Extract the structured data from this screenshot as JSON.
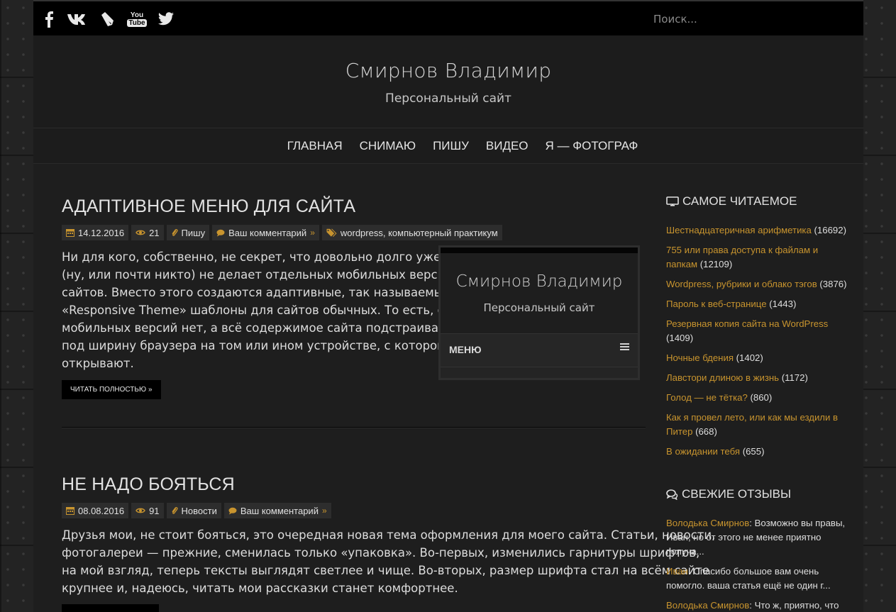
{
  "topbar": {
    "icons": [
      "facebook-icon",
      "vk-icon",
      "livejournal-icon",
      "youtube-icon",
      "twitter-icon"
    ],
    "youtube_you": "You",
    "youtube_tube": "Tube",
    "search_placeholder": "Поиск..."
  },
  "header": {
    "title": "Смирнов Владимир",
    "description": "Персональный сайт"
  },
  "nav": {
    "items": [
      "Главная",
      "Снимаю",
      "Пишу",
      "Видео",
      "Я — фотограф"
    ]
  },
  "posts": [
    {
      "title": "Адаптивное меню для сайта",
      "date": "14.12.2016",
      "views": "21",
      "category": "Пишу",
      "comment_link": "Ваш комментарий",
      "tags": "wordpress, компьютерный практикум",
      "excerpt_lines": [
        "Ни для кого, собственно, не секрет, что довольно долго уже никто",
        "(ну, или почти никто) не делает отдельных мобильных версий",
        "сайтов. Вместо этого создаются адаптивные, так называемые",
        "«Responsive Theme» шаблоны для сайтов обычных. То есть, особых",
        "мобильных версий нет, а всё содержимое сайта подстраивается",
        "под ширину браузера на том или ином устройстве, с которого его",
        "открывают."
      ],
      "read_more": "Читать полностью",
      "thumbnail": {
        "title": "Смирнов Владимир",
        "subtitle": "Персональный сайт",
        "menu_label": "МЕНЮ"
      }
    },
    {
      "title": "Не надо бояться",
      "date": "08.08.2016",
      "views": "91",
      "category": "Новости",
      "comment_link": "Ваш комментарий",
      "excerpt_lines": [
        "Друзья мои, не стоит бояться, это очередная новая тема оформления для моего сайта. Статьи, новости,",
        "фотогалереи — прежние, сменилась только «упаковка». Во-первых, изменились гарнитуры шрифтов,",
        "на мой взгляд, теперь тексты выглядят светлее и чище. Во-вторых, размер шрифта стал на всём сайте",
        "крупнее и, надеюсь, читать мои рассказки станет комфортнее."
      ]
    }
  ],
  "sidebar": {
    "popular_title": "Самое читаемое",
    "popular": [
      {
        "title": "Шестнадцатеричная арифметика",
        "count": "(16692)"
      },
      {
        "title": "755 или права доступа к файлам и папкам",
        "count": "(12109)"
      },
      {
        "title": "Wordpress, рубрики и облако тэгов",
        "count": "(3876)"
      },
      {
        "title": "Пароль к веб-странице",
        "count": "(1443)"
      },
      {
        "title": "Резервная копия сайта на WordPress",
        "count": "(1409)"
      },
      {
        "title": "Ночные бдения",
        "count": "(1402)"
      },
      {
        "title": "Лавстори длиною в жизнь",
        "count": "(1172)"
      },
      {
        "title": "Голод — не тётка?",
        "count": "(860)"
      },
      {
        "title": "Как я провел лето, или как мы ездили в Питер",
        "count": "(668)"
      },
      {
        "title": "В ожидании тебя",
        "count": "(655)"
      }
    ],
    "comments_title": "Свежие отзывы",
    "comments": [
      {
        "author": "Володька Смирнов",
        "text": ": Возможно вы правы, Иван, но от этого не менее приятно получа..."
      },
      {
        "author": "Иван",
        "text": ": Спасибо большое вам очень помогло. ваша статья ещё не один г..."
      },
      {
        "author": "Володька Смирнов",
        "text": ": Что ж, приятно, что"
      }
    ]
  },
  "colors": {
    "accent": "#c8942e",
    "background": "#1e1e1e",
    "topbar": "#000000"
  }
}
